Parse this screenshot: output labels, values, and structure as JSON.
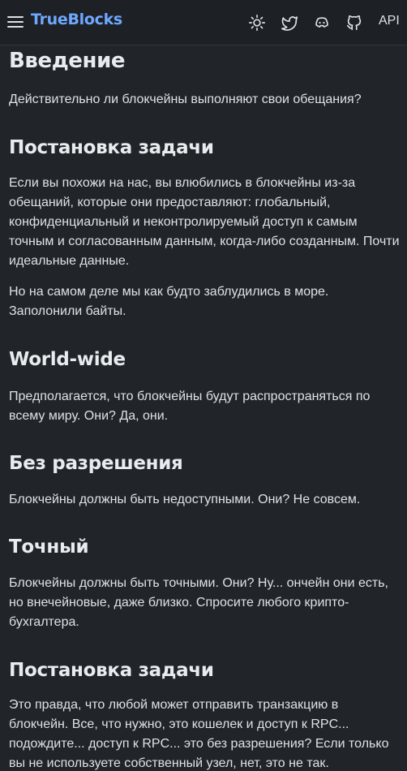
{
  "header": {
    "brand": "TrueBlocks",
    "api_label": "API",
    "icons": [
      "menu-icon",
      "sun-icon",
      "twitter-icon",
      "discord-icon",
      "github-icon"
    ]
  },
  "article": {
    "title": "Введение",
    "intro": "Действительно ли блокчейны выполняют свои обещания?",
    "sections": [
      {
        "heading": "Постановка задачи",
        "paragraphs": [
          "Если вы похожи на нас, вы влюбились в блокчейны из-за обещаний, которые они предоставляют: глобальный, конфиденциальный и неконтролируемый доступ к самым точным и согласованным данным, когда-либо созданным. Почти идеальные данные.",
          "Но на самом деле мы как будто заблудились в море. Заполонили байты."
        ]
      },
      {
        "heading": "World-wide",
        "paragraphs": [
          "Предполагается, что блокчейны будут распространяться по всему миру. Они? Да, они."
        ]
      },
      {
        "heading": "Без разрешения",
        "paragraphs": [
          "Блокчейны должны быть недоступными. Они? Не совсем."
        ]
      },
      {
        "heading": "Точный",
        "paragraphs": [
          "Блокчейны должны быть точными. Они? Ну... ончейн они есть, но внечейновые, даже близко. Спросите любого крипто-бухгалтера."
        ]
      },
      {
        "heading": "Постановка задачи",
        "paragraphs": [
          "Это правда, что любой может отправить транзакцию в блокчейн. Все, что нужно, это кошелек и доступ к RPC... подождите... доступ к RPC... это без разрешения? Если только вы не используете собственный узел, нет, это не так."
        ]
      }
    ]
  }
}
